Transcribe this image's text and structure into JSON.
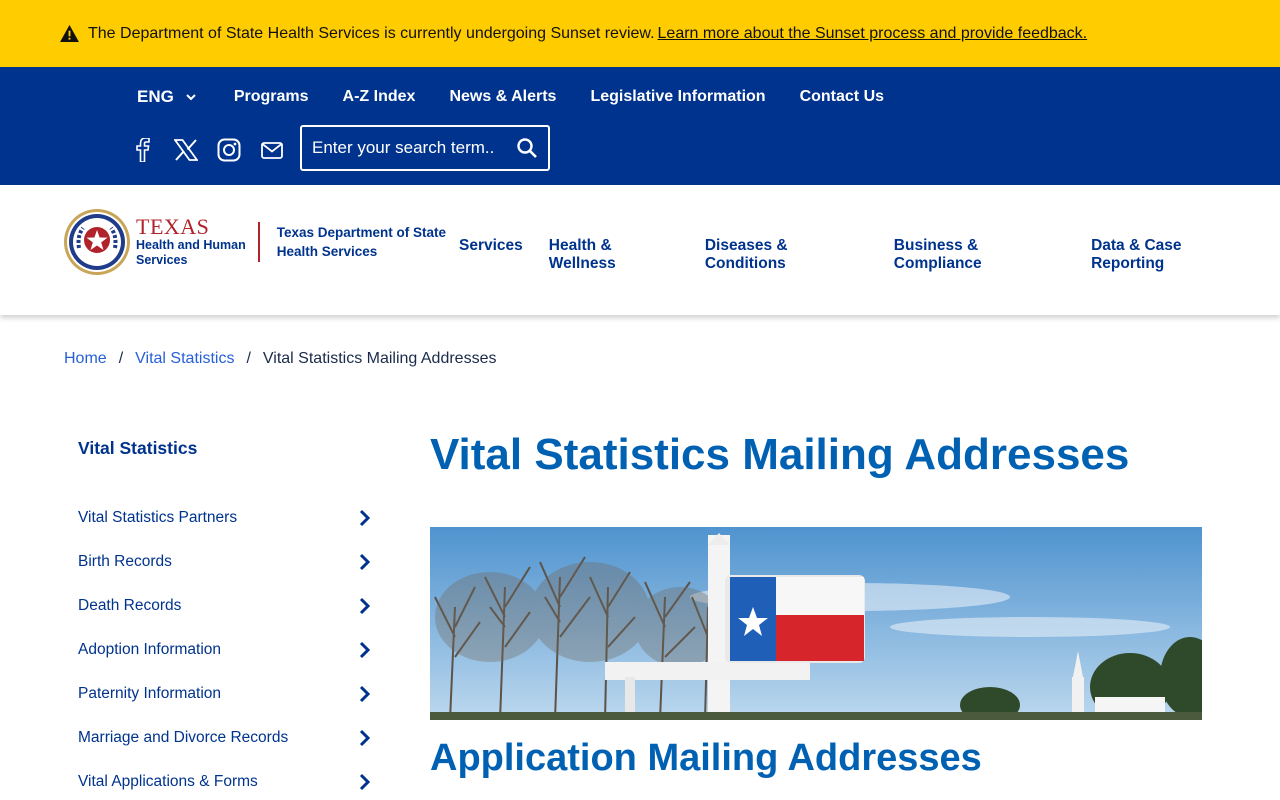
{
  "alert": {
    "text": "The Department of State Health Services is currently undergoing Sunset review.",
    "link": "Learn more about the Sunset process and provide feedback."
  },
  "util_nav": {
    "language": "ENG",
    "links": [
      "Programs",
      "A-Z Index",
      "News & Alerts",
      "Legislative Information",
      "Contact Us"
    ]
  },
  "social": [
    "facebook-icon",
    "x-icon",
    "instagram-icon",
    "email-icon"
  ],
  "search": {
    "placeholder": "Enter your search term.."
  },
  "logo": {
    "texas": "TEXAS",
    "hhs_line1": "Health and Human",
    "hhs_line2": "Services",
    "dept_line1": "Texas Department of State",
    "dept_line2": "Health Services"
  },
  "main_nav": [
    "Services",
    "Health & Wellness",
    "Diseases & Conditions",
    "Business & Compliance",
    "Data & Case Reporting"
  ],
  "breadcrumb": {
    "home": "Home",
    "parent": "Vital Statistics",
    "current": "Vital Statistics Mailing Addresses"
  },
  "sidebar": {
    "title": "Vital Statistics",
    "items": [
      "Vital Statistics Partners",
      "Birth Records",
      "Death Records",
      "Adoption Information",
      "Paternity Information",
      "Marriage and Divorce Records",
      "Vital Applications & Forms"
    ]
  },
  "page": {
    "title": "Vital Statistics Mailing Addresses",
    "section_title": "Application Mailing Addresses"
  },
  "colors": {
    "alert_bg": "#ffcc00",
    "util_bg": "#00338d",
    "heading": "#0061b3",
    "link": "#2660d8",
    "brand_red": "#b1232b"
  }
}
